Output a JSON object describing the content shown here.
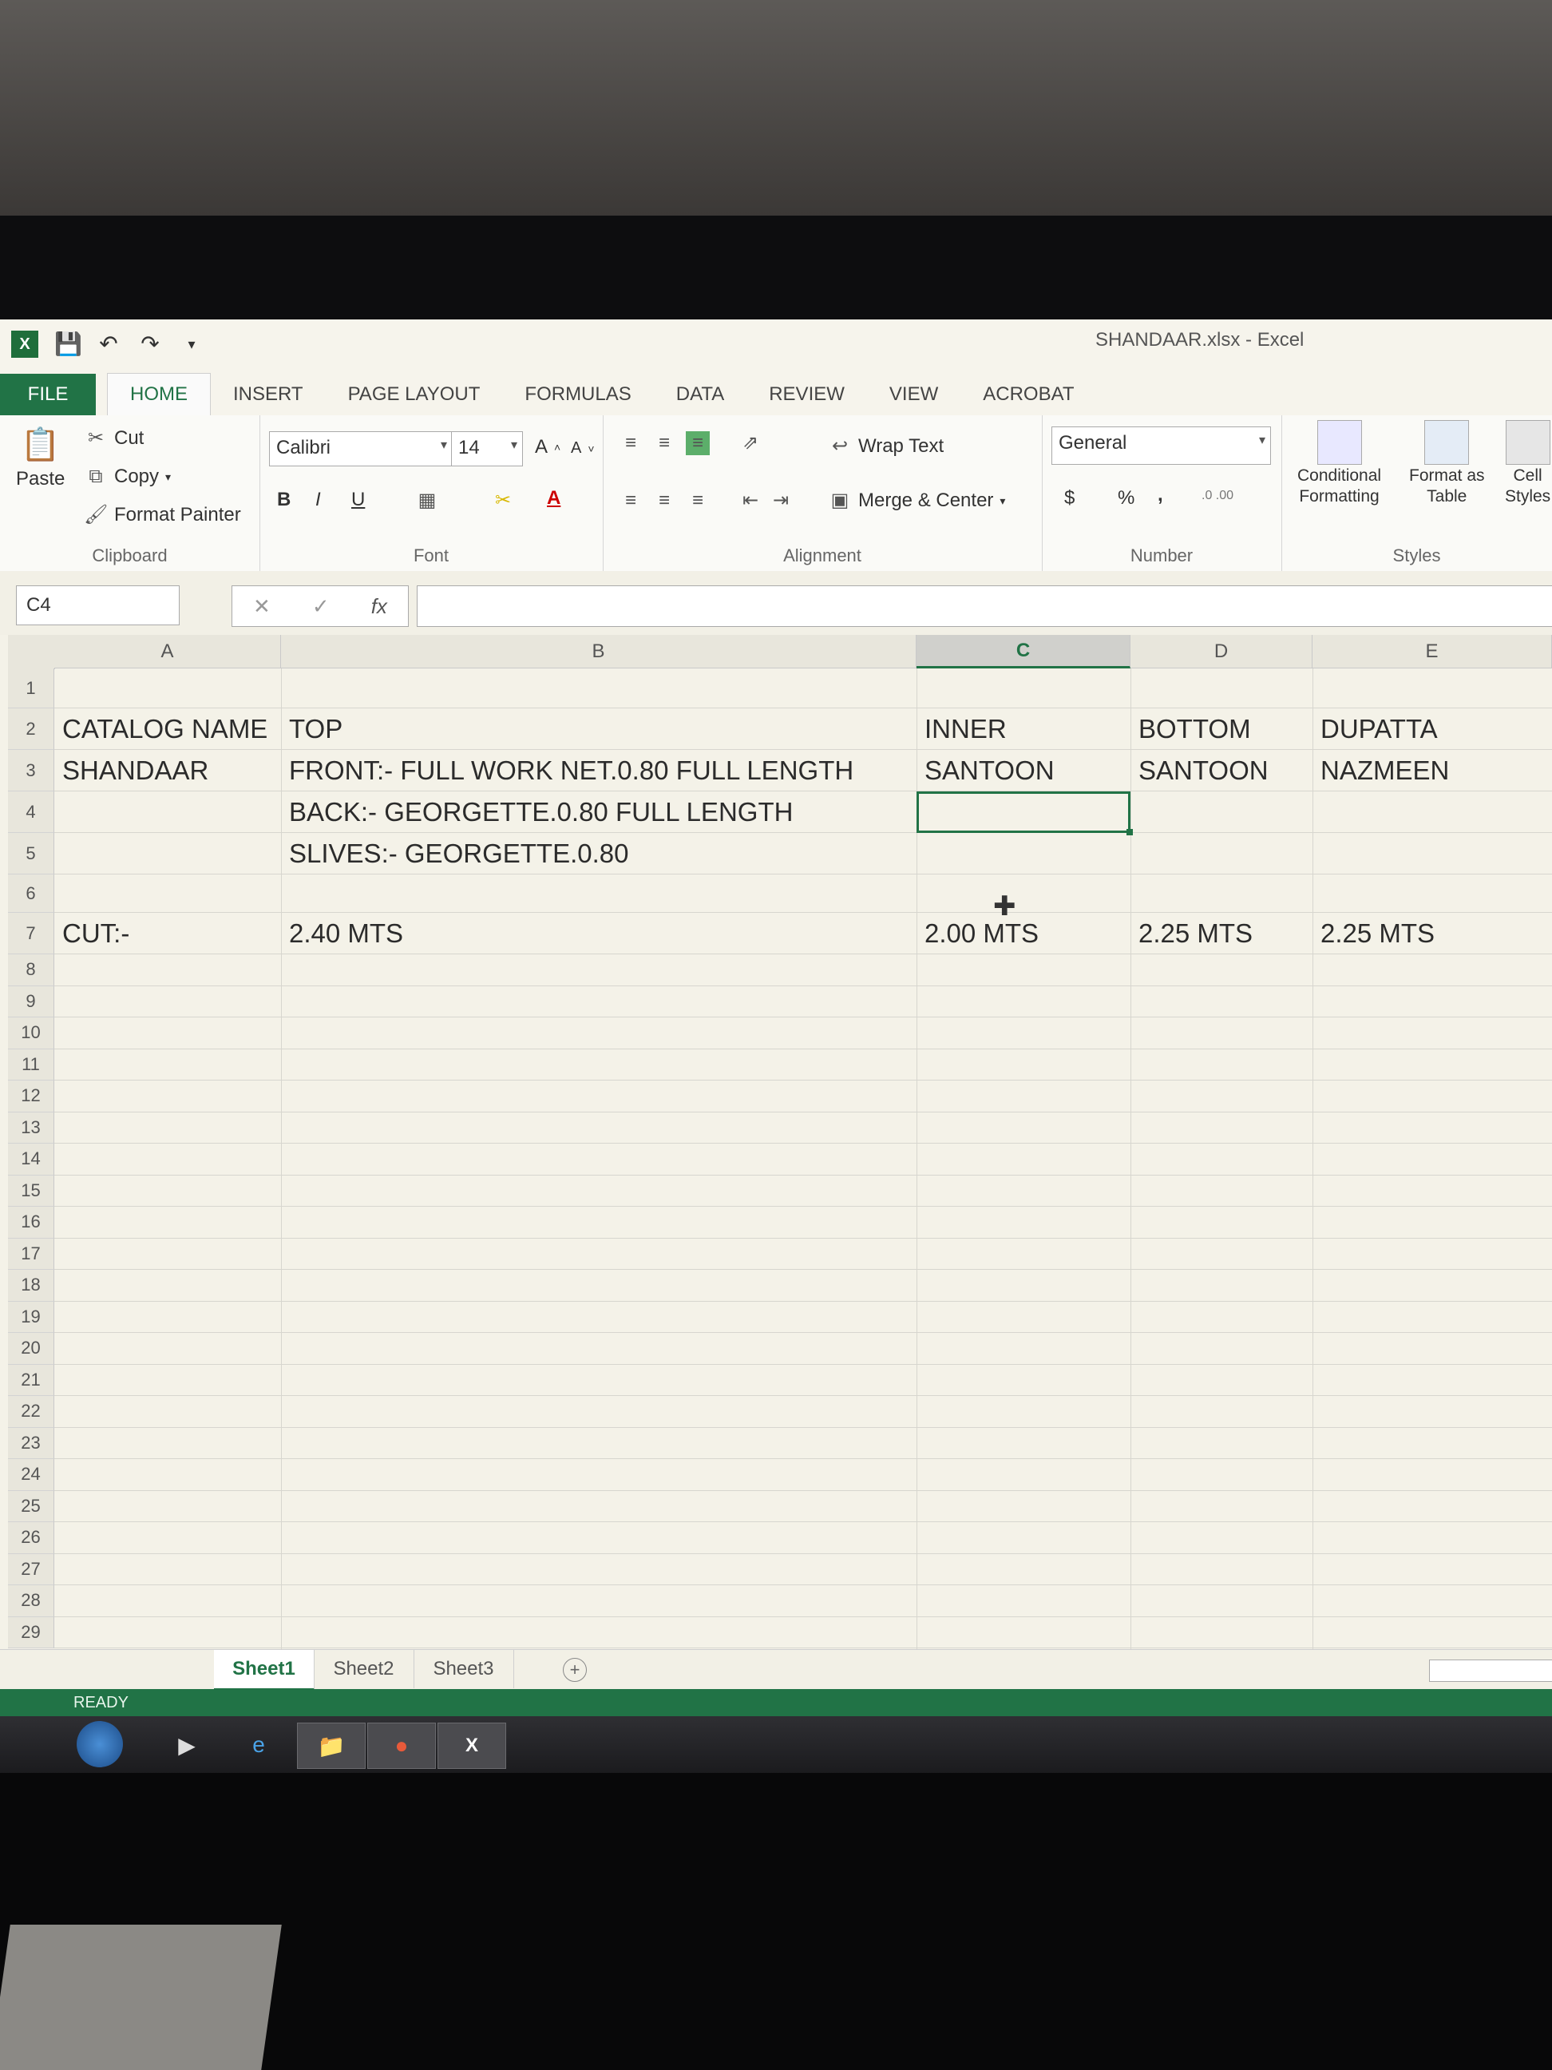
{
  "window": {
    "title": "SHANDAAR.xlsx - Excel",
    "app_badge": "X"
  },
  "ribbon_tabs": [
    "FILE",
    "HOME",
    "INSERT",
    "PAGE LAYOUT",
    "FORMULAS",
    "DATA",
    "REVIEW",
    "VIEW",
    "ACROBAT"
  ],
  "clipboard": {
    "paste": "Paste",
    "cut": "Cut",
    "copy": "Copy",
    "format_painter": "Format Painter",
    "label": "Clipboard"
  },
  "font": {
    "name": "Calibri",
    "size": "14",
    "bold": "B",
    "italic": "I",
    "underline": "U",
    "grow": "A",
    "shrink": "A",
    "label": "Font"
  },
  "alignment": {
    "wrap_text": "Wrap Text",
    "merge_center": "Merge & Center",
    "label": "Alignment"
  },
  "number": {
    "format": "General",
    "currency": "$",
    "percent": "%",
    "comma": ",",
    "label": "Number"
  },
  "styles": {
    "conditional": "Conditional",
    "conditional2": "Formatting",
    "format_as": "Format as",
    "table": "Table",
    "cell": "Cell",
    "cell2": "Styles",
    "label": "Styles"
  },
  "formula_bar": {
    "name_box": "C4",
    "fx": "fx",
    "value": ""
  },
  "columns": [
    "A",
    "B",
    "C",
    "D",
    "E"
  ],
  "rows": [
    "1",
    "2",
    "3",
    "4",
    "5",
    "6",
    "7",
    "8",
    "9",
    "10",
    "11",
    "12",
    "13",
    "14",
    "15",
    "16",
    "17",
    "18",
    "19",
    "20",
    "21",
    "22",
    "23",
    "24",
    "25",
    "26",
    "27",
    "28",
    "29"
  ],
  "cells": {
    "A2": "CATALOG NAME",
    "B2": "TOP",
    "C2": "INNER",
    "D2": "BOTTOM",
    "E2": "DUPATTA",
    "A3": "SHANDAAR",
    "B3": "FRONT:- FULL WORK NET.0.80 FULL LENGTH",
    "C3": "SANTOON",
    "D3": "SANTOON",
    "E3": "NAZMEEN",
    "B4": "BACK:- GEORGETTE.0.80 FULL LENGTH",
    "B5": "SLIVES:- GEORGETTE.0.80",
    "A7": "CUT:-",
    "B7": "2.40 MTS",
    "C7": "2.00 MTS",
    "D7": "2.25 MTS",
    "E7": "2.25 MTS"
  },
  "selected_cell": "C4",
  "sheets": [
    "Sheet1",
    "Sheet2",
    "Sheet3"
  ],
  "active_sheet": "Sheet1",
  "status": "READY",
  "colors": {
    "excel_green": "#217346"
  }
}
